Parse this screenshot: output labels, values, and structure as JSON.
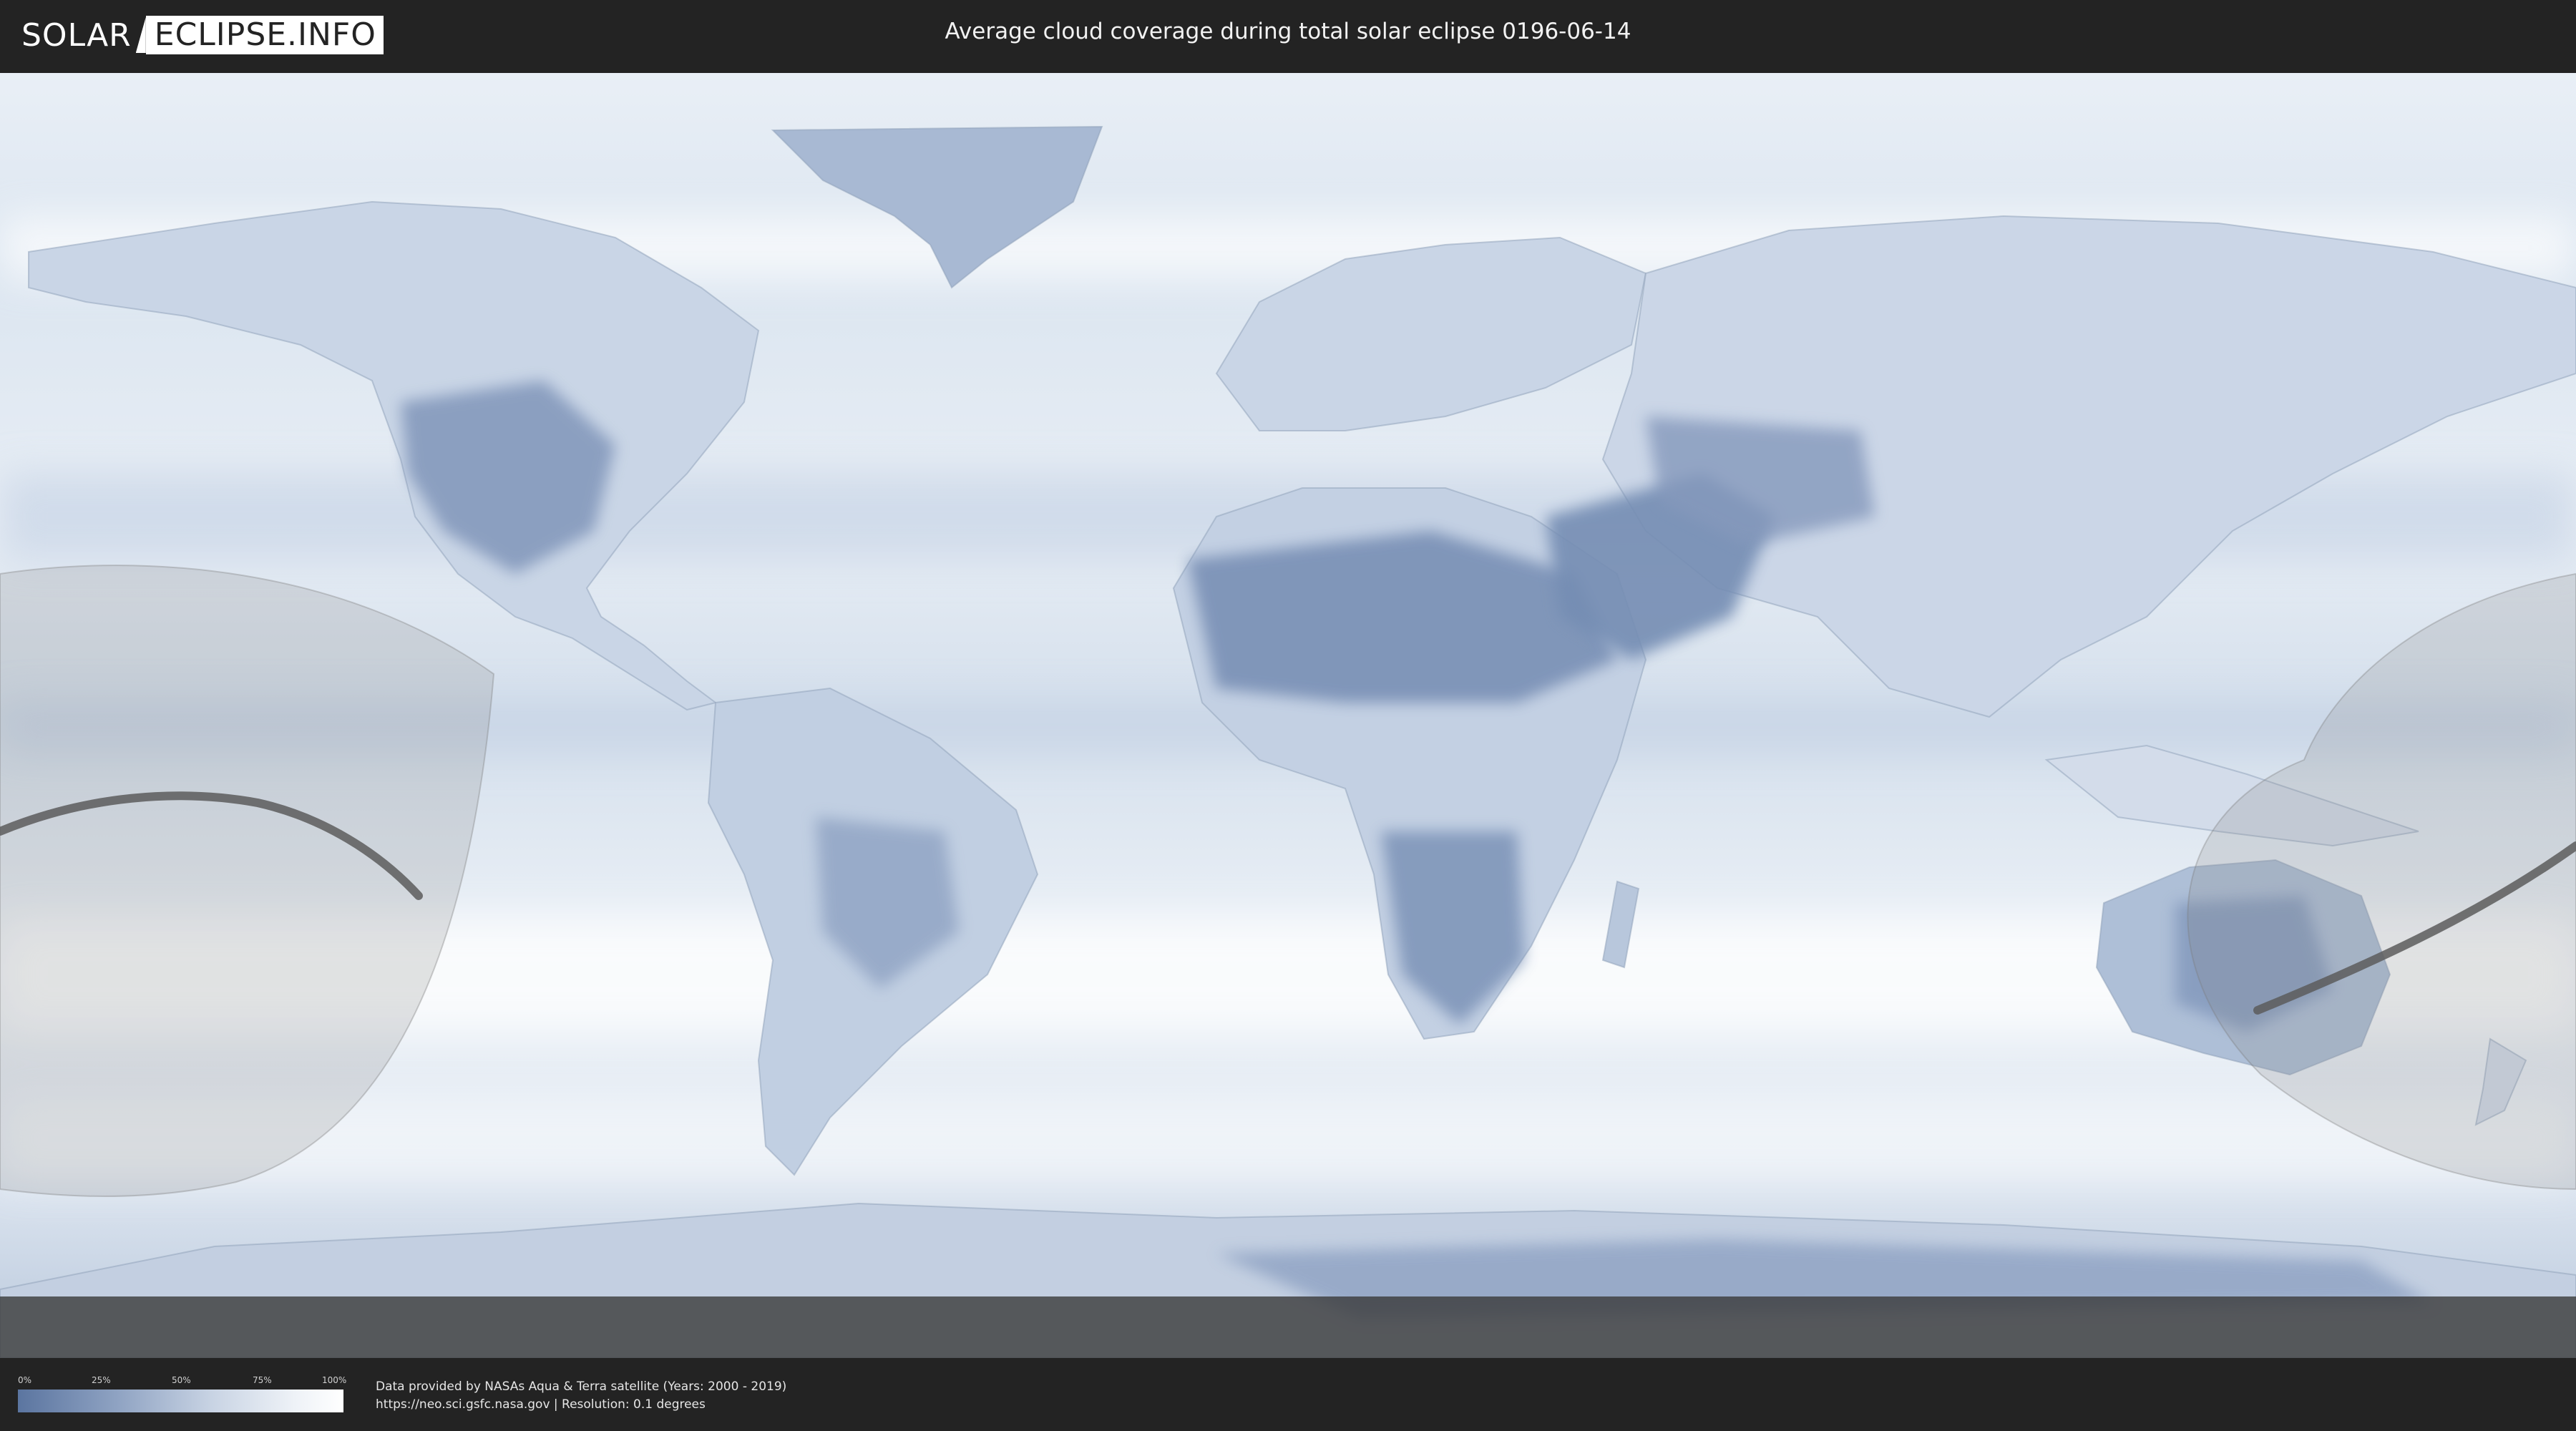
{
  "header": {
    "logo_part1": "SOLAR",
    "logo_part2": "ECLIPSE.INFO",
    "title": "Average cloud coverage during total solar eclipse 0196-06-14"
  },
  "map": {
    "layer": "average cloud coverage",
    "projection": "equirectangular",
    "cloud_color_clear": "#5b75a0",
    "cloud_color_full": "#ffffff",
    "eclipse_shadow_color": "#8a8a8a"
  },
  "legend": {
    "ticks": [
      "0%",
      "25%",
      "50%",
      "75%",
      "100%"
    ]
  },
  "footer": {
    "line1": "Data provided by NASAs Aqua & Terra satellite (Years: 2000 - 2019)",
    "line2": "https://neo.sci.gsfc.nasa.gov | Resolution: 0.1 degrees"
  }
}
